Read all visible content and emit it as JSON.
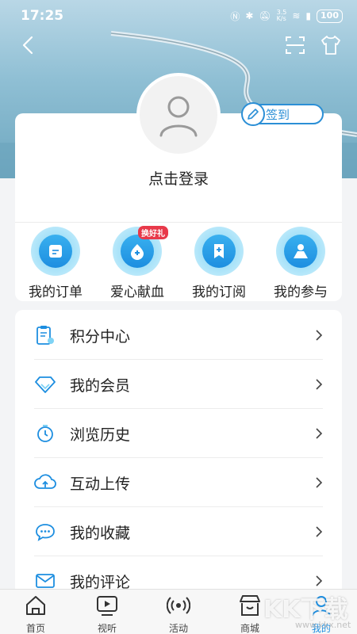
{
  "status_bar": {
    "time": "17:25",
    "icons": [
      "nfc-icon",
      "bluetooth-icon",
      "mute-icon",
      "network-speed-icon",
      "wifi-icon",
      "alert-icon"
    ],
    "network_speed": "3.5\nK/s",
    "battery": "100"
  },
  "header": {
    "back_icon": "chevron-left-icon",
    "scan_icon": "scan-icon",
    "skin_icon": "shirt-icon"
  },
  "profile": {
    "checkin_label": "签到",
    "login_label": "点击登录"
  },
  "quick_actions": [
    {
      "label": "我的订单",
      "icon": "order-icon"
    },
    {
      "label": "爱心献血",
      "icon": "blood-donation-icon",
      "badge": "换好礼"
    },
    {
      "label": "我的订阅",
      "icon": "subscription-icon"
    },
    {
      "label": "我的参与",
      "icon": "participation-icon"
    }
  ],
  "menu": [
    {
      "label": "积分中心",
      "icon": "points-icon"
    },
    {
      "label": "我的会员",
      "icon": "diamond-icon"
    },
    {
      "label": "浏览历史",
      "icon": "clock-icon"
    },
    {
      "label": "互动上传",
      "icon": "cloud-upload-icon"
    },
    {
      "label": "我的收藏",
      "icon": "chat-bubble-icon"
    },
    {
      "label": "我的评论",
      "icon": "mail-icon"
    }
  ],
  "tabs": [
    {
      "label": "首页",
      "icon": "home-icon"
    },
    {
      "label": "视听",
      "icon": "video-play-icon"
    },
    {
      "label": "活动",
      "icon": "broadcast-icon"
    },
    {
      "label": "商城",
      "icon": "store-icon"
    },
    {
      "label": "我的",
      "icon": "user-icon",
      "active": true
    }
  ],
  "watermark": {
    "text": "KK下载",
    "sub": "www.kkx.net"
  },
  "colors": {
    "accent": "#1d8ee0",
    "badge": "#e8394a",
    "background": "#f3f4f6"
  }
}
